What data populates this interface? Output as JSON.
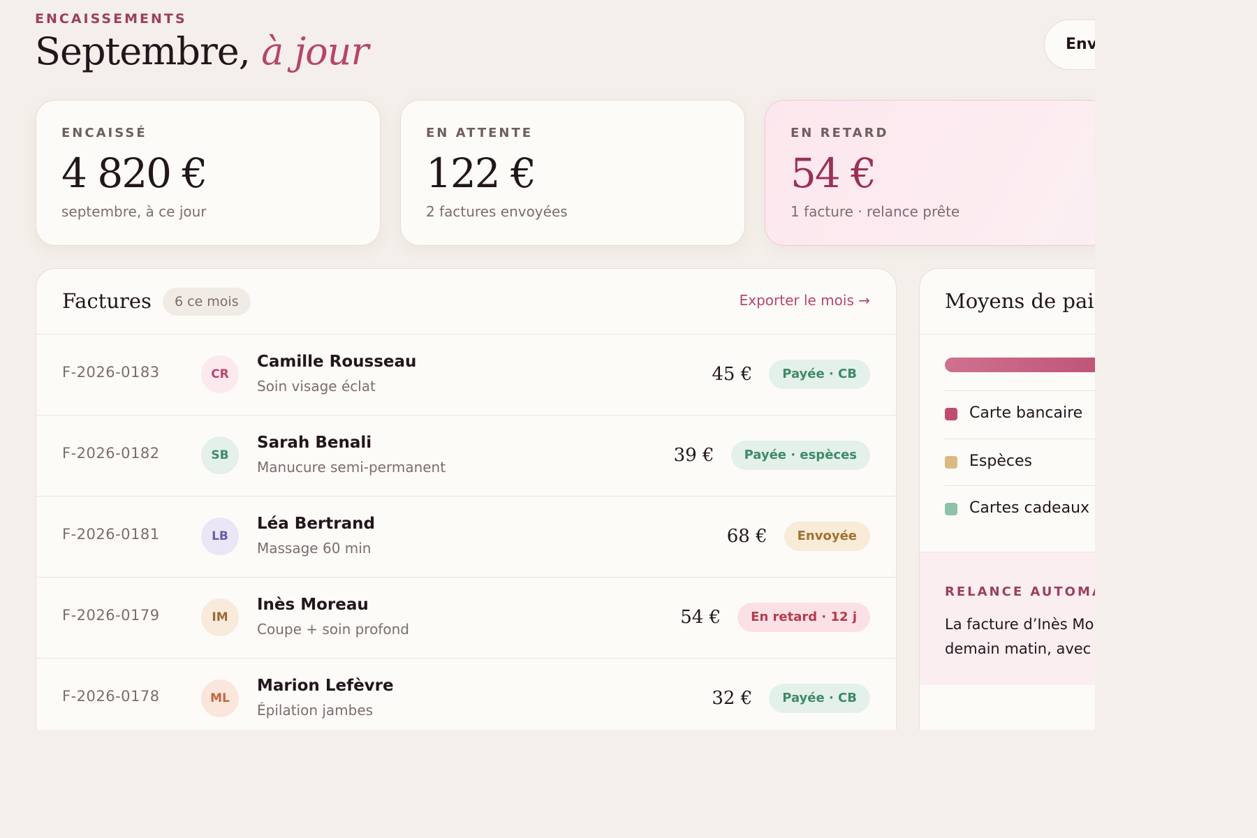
{
  "header": {
    "eyebrow": "ENCAISSEMENTS",
    "title_main": "Septembre,",
    "title_accent": "à jour",
    "action_button": "Env"
  },
  "kpis": [
    {
      "label": "ENCAISSÉ",
      "value": "4 820 €",
      "sub": "septembre, à ce jour"
    },
    {
      "label": "EN ATTENTE",
      "value": "122 €",
      "sub": "2 factures envoyées"
    },
    {
      "label": "EN RETARD",
      "value": "54 €",
      "sub": "1 facture · relance prête"
    }
  ],
  "invoices": {
    "title": "Factures",
    "count": "6 ce mois",
    "export": "Exporter le mois →",
    "rows": [
      {
        "id": "F-2026-0183",
        "initials": "CR",
        "client": "Camille Rousseau",
        "service": "Soin visage éclat",
        "amount": "45 €",
        "status": "Payée · CB"
      },
      {
        "id": "F-2026-0182",
        "initials": "SB",
        "client": "Sarah Benali",
        "service": "Manucure semi-permanent",
        "amount": "39 €",
        "status": "Payée · espèces"
      },
      {
        "id": "F-2026-0181",
        "initials": "LB",
        "client": "Léa Bertrand",
        "service": "Massage 60 min",
        "amount": "68 €",
        "status": "Envoyée"
      },
      {
        "id": "F-2026-0179",
        "initials": "IM",
        "client": "Inès Moreau",
        "service": "Coupe + soin profond",
        "amount": "54 €",
        "status": "En retard · 12 j"
      },
      {
        "id": "F-2026-0178",
        "initials": "ML",
        "client": "Marion Lefèvre",
        "service": "Épilation jambes",
        "amount": "32 €",
        "status": "Payée · CB"
      }
    ]
  },
  "payment_methods": {
    "title": "Moyens de paie",
    "items": [
      {
        "label": "Carte bancaire",
        "color": "#c04d6f"
      },
      {
        "label": "Espèces",
        "color": "#dcb882"
      },
      {
        "label": "Cartes cadeaux",
        "color": "#8fc1a8"
      }
    ],
    "reminder": {
      "label": "RELANCE AUTOMAT",
      "text_line1": "La facture d’Inès Mo",
      "text_line2": "demain matin, avec"
    }
  },
  "colors": {
    "accent": "#b5456c",
    "background": "#f4efea",
    "paid": "#3f8a68",
    "sent": "#a2702f",
    "late": "#b53a4e"
  }
}
